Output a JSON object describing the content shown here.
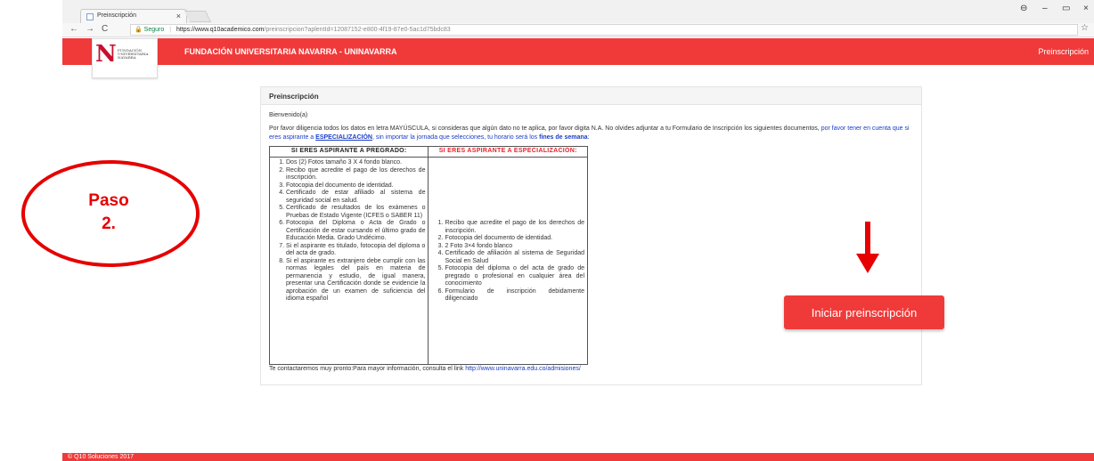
{
  "browser": {
    "tab_title": "Preinscripción",
    "tab_close": "×",
    "nav_back": "←",
    "nav_forward": "→",
    "nav_reload": "C",
    "secure_label": "Seguro",
    "url_host": "https://www.q10academico.com",
    "url_path": "/preinscripcion?aplentId=12087152-e800-4f19-87e0-5ac1d75bdc83",
    "win_profile": "⊖",
    "win_min": "–",
    "win_max": "▭",
    "win_close": "×",
    "star": "☆"
  },
  "header": {
    "title": "FUNDACIÓN UNIVERSITARIA NAVARRA - UNINAVARRA",
    "link": "Preinscripción",
    "logo_letter": "N",
    "logo_text": "FUNDACIÓN UNIVERSITARIA NAVARRA"
  },
  "panel": {
    "title": "Preinscripción",
    "welcome": "Bienvenido(a)",
    "intro_1": "Por favor diligencia todos los datos en letra MAYÚSCULA, si consideras que algún dato no te aplica, por favor digita N.A. No olvides adjuntar a tu Formulario de Inscripción los siguientes documentos, ",
    "intro_2": "por favor tener en cuenta que si eres aspirante a ",
    "intro_3": "ESPECIALIZACIÓN",
    "intro_4": ", sin importar la jornada que selecciones, tu horario será los ",
    "intro_5": "fines de semana",
    "intro_6": ":",
    "table": {
      "head_pregrado": "SI ERES ASPIRANTE A PREGRADO:",
      "head_especializacion": "SI ERES ASPIRANTE A ESPECIALIZACIÓN:",
      "pregrado": [
        "Dos (2) Fotos tamaño 3 X 4 fondo blanco.",
        "Recibo que acredite el pago de los derechos de inscripción.",
        "Fotocopia del documento de identidad.",
        "Certificado de estar afiliado al sistema de seguridad social en salud.",
        "Certificado de resultados de los exámenes o Pruebas de Estado Vigente (ICFES o SABER 11)",
        "Fotocopia del Diploma o Acta de Grado o Certificación de estar cursando el último grado de Educación Media. Grado Undécimo.",
        "Si el aspirante es titulado, fotocopia del diploma o del acta de grado.",
        "Si el aspirante es extranjero debe cumplir con las normas legales del país en materia de permanencia y estudio, de igual manera, presentar una Certificación donde se evidencie la aprobación de un examen de suficiencia del idioma español"
      ],
      "especializacion": [
        "Recibo que acredite el pago de los derechos de inscripción.",
        "Fotocopia del documento de identidad.",
        "2 Foto 3×4 fondo blanco",
        "Certificado de afiliación al sistema de Seguridad Social en Salud",
        "Fotocopia del diploma o del acta de grado de pregrado o profesional en cualquier área del conocimiento",
        "Formulario de inscripción debidamente diligenciado"
      ]
    },
    "contact_text": "Te contactaremos muy pronto:Para mayor información, consulta el link ",
    "contact_link": "http://www.uninavarra.edu.co/admisiones/"
  },
  "annotation": {
    "step_line1": "Paso",
    "step_line2": "2.",
    "color": "#e60000"
  },
  "cta": {
    "label": "Iniciar preinscripción",
    "color": "#f03a3a"
  },
  "footer": {
    "text": "© Q10 Soluciones 2017"
  }
}
